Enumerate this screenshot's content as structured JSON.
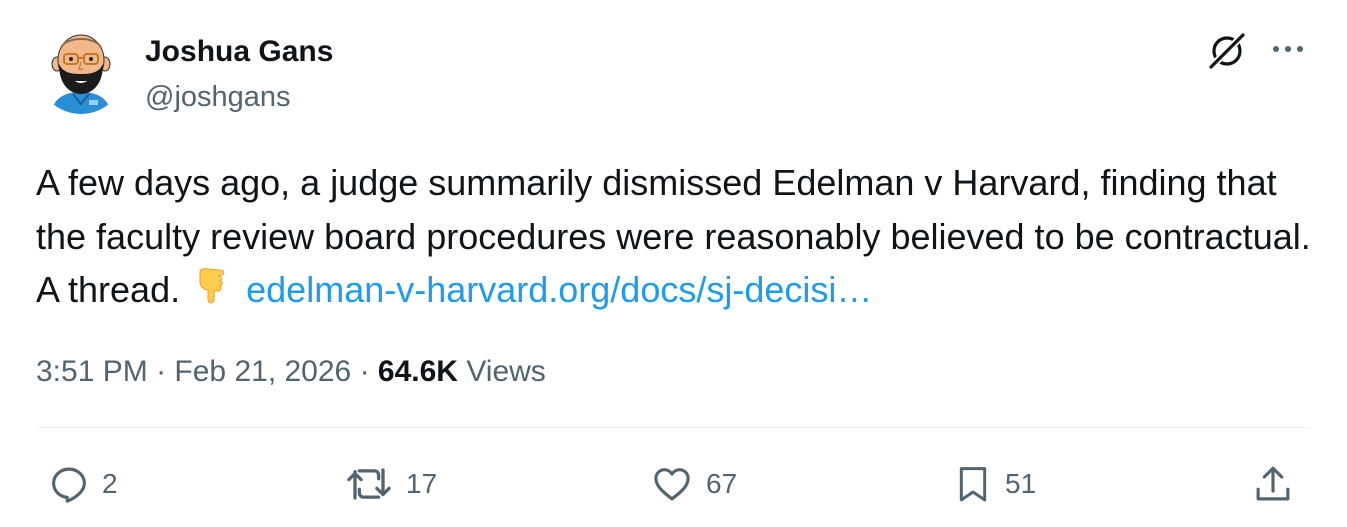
{
  "author": {
    "name": "Joshua Gans",
    "handle": "@joshgans"
  },
  "header_icons": [
    "grok-icon",
    "more-icon"
  ],
  "tweet": {
    "text_before_link": "A few days ago, a judge summarily dismissed Edelman v Harvard, finding that the faculty review board procedures were reasonably believed to be contractual. A thread.",
    "emoji": "backhand-index-pointing-down-emoji",
    "link_text": "edelman-v-harvard.org/docs/sj-decisi…"
  },
  "meta": {
    "time": "3:51 PM",
    "separator": "·",
    "date": "Feb 21, 2026",
    "views_count": "64.6K",
    "views_label": "Views"
  },
  "actions": {
    "replies": "2",
    "reposts": "17",
    "likes": "67",
    "bookmarks": "51"
  },
  "colors": {
    "text": "#0f1419",
    "secondary": "#536471",
    "link": "#1d9bf0",
    "divider": "#eff3f4"
  }
}
